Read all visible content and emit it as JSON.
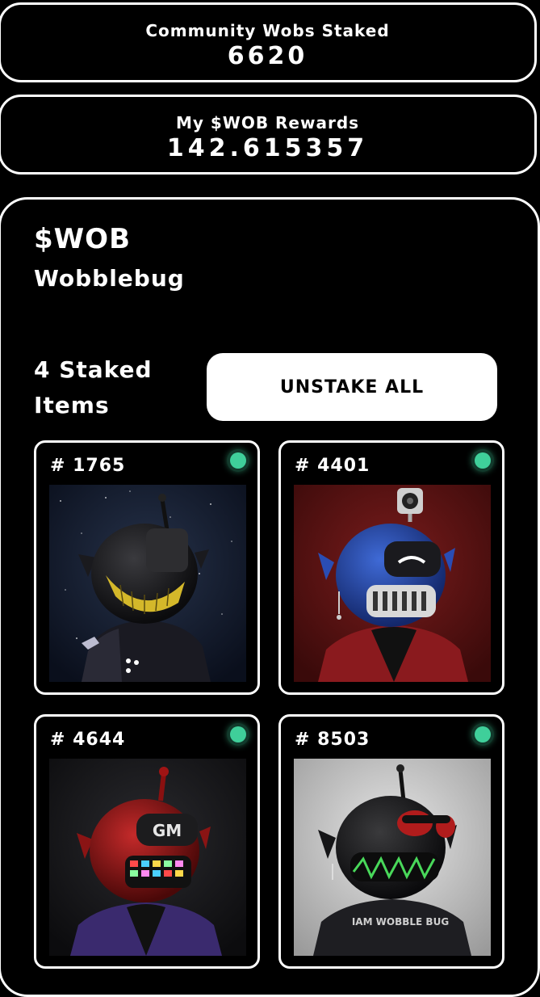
{
  "stats": {
    "community_label": "Community Wobs Staked",
    "community_value": "6620",
    "rewards_label": "My $WOB Rewards",
    "rewards_value": "142.615357"
  },
  "token": {
    "symbol": "$WOB",
    "name": "Wobblebug"
  },
  "staking": {
    "count_label": "4 Staked Items",
    "unstake_label": "UNSTAKE ALL"
  },
  "items": [
    {
      "id": "# 1765",
      "status_color": "#3fcf9a"
    },
    {
      "id": "# 4401",
      "status_color": "#3fcf9a"
    },
    {
      "id": "# 4644",
      "status_color": "#3fcf9a"
    },
    {
      "id": "# 8503",
      "status_color": "#3fcf9a"
    }
  ],
  "art": {
    "hoodie_text": "IAM WOBBLE BUG",
    "visor_text": "GM"
  }
}
